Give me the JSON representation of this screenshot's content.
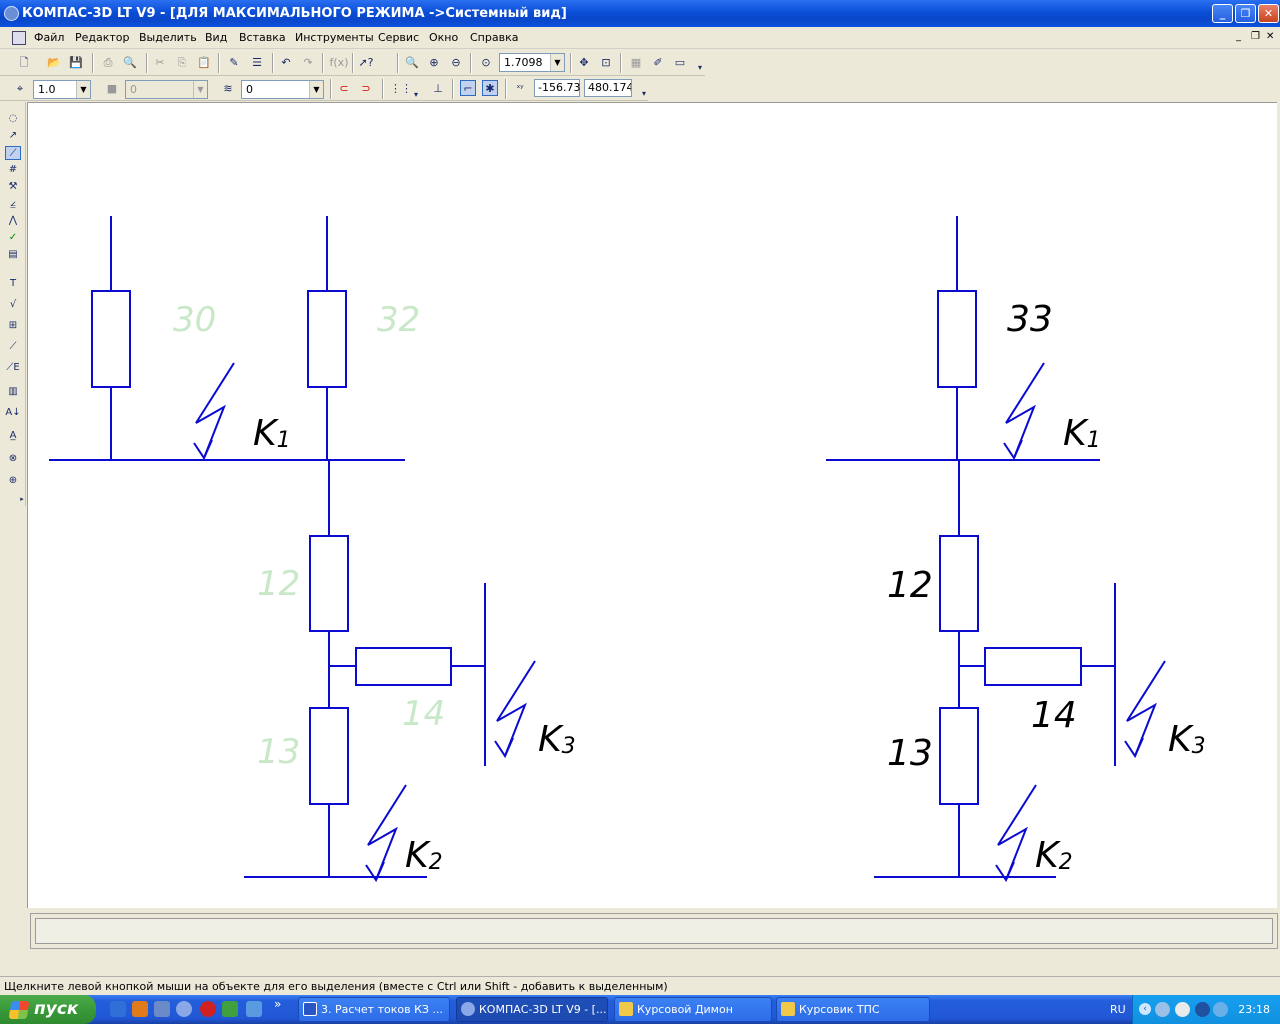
{
  "window": {
    "title": "КОМПАС-3D LT V9 - [ДЛЯ МАКСИМАЛЬНОГО РЕЖИМА ->Системный вид]"
  },
  "menu": [
    "Файл",
    "Редактор",
    "Выделить",
    "Вид",
    "Вставка",
    "Инструменты",
    "Сервис",
    "Окно",
    "Справка"
  ],
  "toolbar": {
    "zoom_value": "1.7098",
    "line_scale": "1.0",
    "style_value": "0",
    "layer_value": "0",
    "coord_x": "-156.73",
    "coord_y": "480.174",
    "fx_label": "f(x)"
  },
  "drawing": {
    "left_labels": {
      "r30": "30",
      "r32": "32",
      "r12": "12",
      "r14": "14",
      "r13": "13",
      "k1": "K",
      "k1sub": "1",
      "k2": "K",
      "k2sub": "2",
      "k3": "K",
      "k3sub": "3"
    },
    "right_labels": {
      "r33": "33",
      "r12": "12",
      "r14": "14",
      "r13": "13",
      "k1": "K",
      "k1sub": "1",
      "k2": "K",
      "k2sub": "2",
      "k3": "K",
      "k3sub": "3"
    },
    "colors": {
      "line": "#0a0ad0",
      "faint_label": "#c8e8c8",
      "label": "#000000"
    }
  },
  "status": {
    "hint": "Щелкните левой кнопкой мыши на объекте для его выделения (вместе с Ctrl или Shift - добавить к выделенным)"
  },
  "taskbar": {
    "start_label": "пуск",
    "tasks": [
      "3. Расчет токов КЗ ...",
      "КОМПАС-3D LT V9 - [...",
      "Курсовой Димон",
      "Курсовик ТПС"
    ],
    "lang": "RU",
    "clock": "23:18"
  }
}
